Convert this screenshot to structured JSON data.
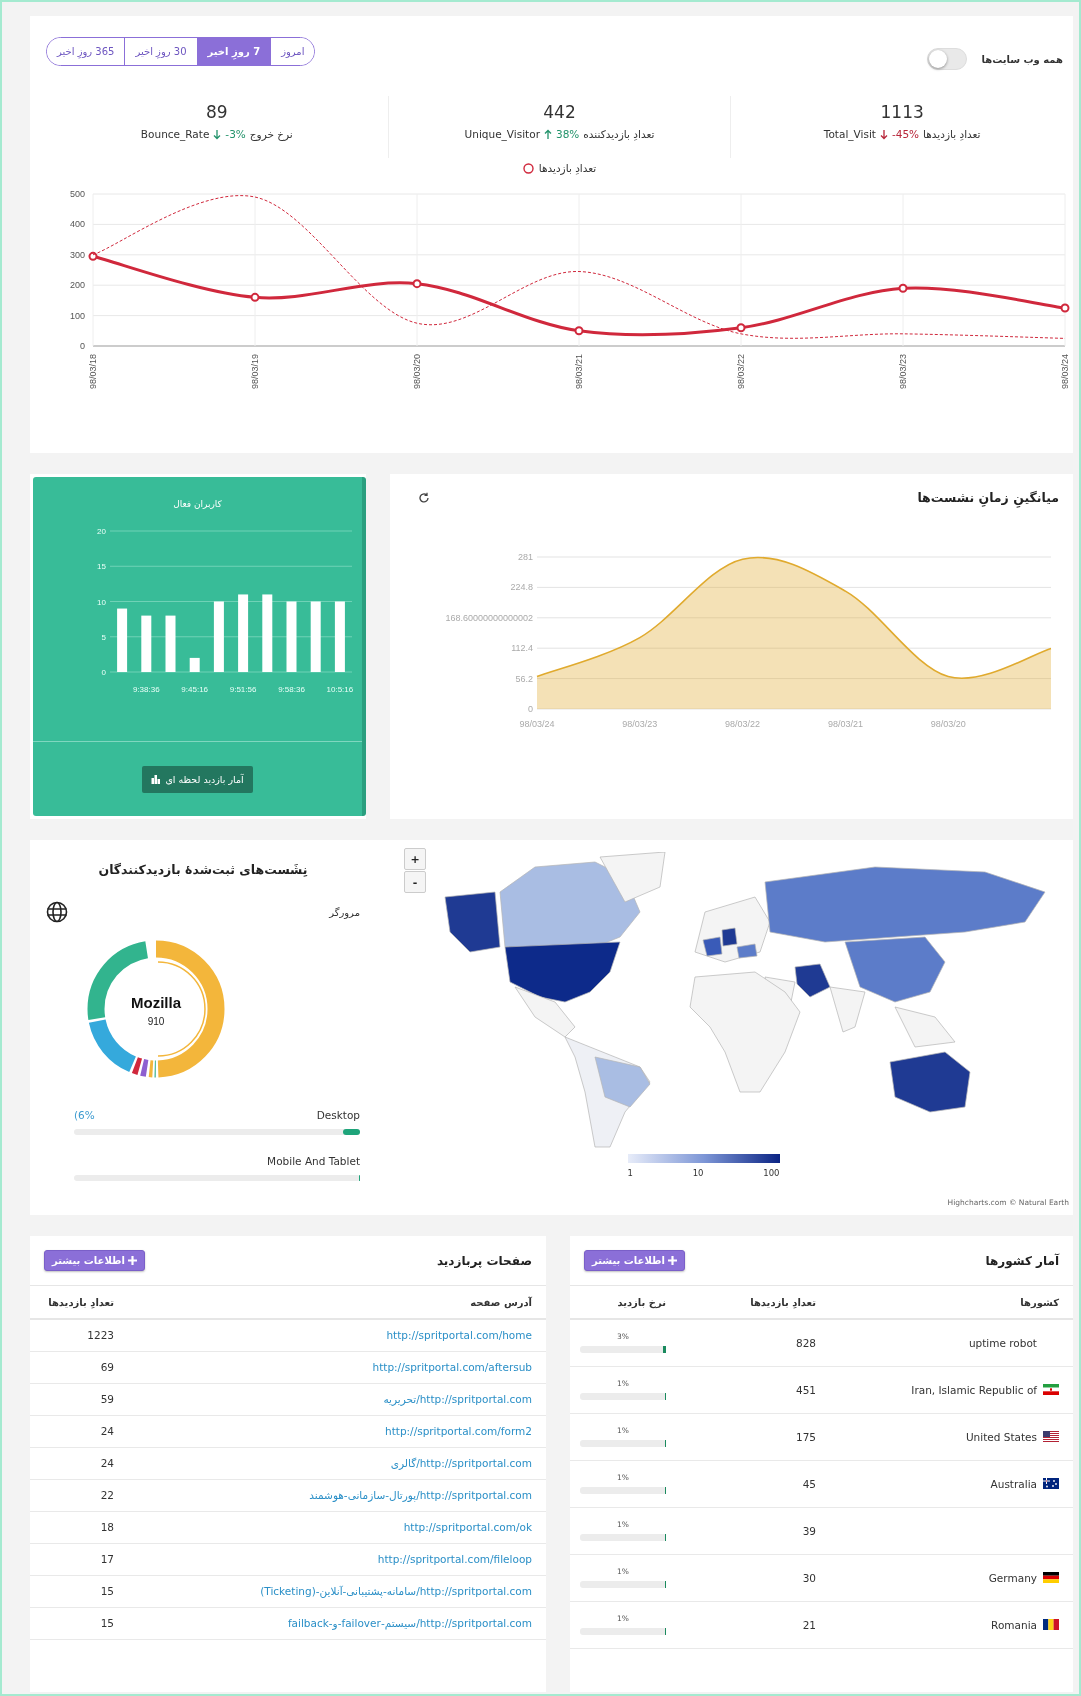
{
  "filters": {
    "all_sites": {
      "label": "همه وب سایت‌ها",
      "on": false
    },
    "tabs": [
      {
        "label": "امروز",
        "selected": false
      },
      {
        "label": "7 روزِ اخیر",
        "selected": true
      },
      {
        "label": "30 روزِ اخیر",
        "selected": false
      },
      {
        "label": "365 روزِ اخیر",
        "selected": false
      }
    ]
  },
  "stats": [
    {
      "value": "1113",
      "label": "تعدادِ بازدیدها",
      "change": "-45%",
      "color": "#b8263a",
      "key": "Total_Visit"
    },
    {
      "value": "442",
      "label": "تعدادِ بازدیدکننده",
      "change": "38%",
      "color": "#23936b",
      "key": "Unique_Visitor"
    },
    {
      "value": "89",
      "label": "نرخ خروج",
      "change": "-3%",
      "color": "#23936b",
      "key": "Bounce_Rate"
    }
  ],
  "visits_chart": {
    "chart_data": {
      "type": "line",
      "categories": [
        "98/03/18",
        "98/03/19",
        "98/03/20",
        "98/03/21",
        "98/03/22",
        "98/03/23",
        "98/03/24"
      ],
      "ylim": [
        0,
        500
      ],
      "yticks": [
        0,
        100,
        200,
        300,
        400,
        500
      ],
      "grid": true,
      "series": [
        {
          "name": "تعدادِ بازدیدها",
          "color": "#d0283c",
          "line_style": "solid",
          "marker": true,
          "values": [
            295,
            160,
            205,
            50,
            60,
            190,
            125
          ]
        },
        {
          "color": "#d0283c",
          "line_style": "dashed",
          "marker": false,
          "values": [
            300,
            490,
            75,
            245,
            40,
            40,
            25
          ]
        }
      ]
    }
  },
  "live_users": {
    "title": "کاربران فعال",
    "chart_data": {
      "type": "bar",
      "categories": [
        null,
        "9:38:36",
        null,
        "9:45:16",
        null,
        "9:51:56",
        null,
        "9:58:36",
        null,
        "10:5:16"
      ],
      "values": [
        9,
        8,
        8,
        2,
        10,
        11,
        11,
        10,
        10,
        10
      ],
      "ylim": [
        0,
        20
      ],
      "yticks": [
        0,
        5,
        10,
        15,
        20
      ],
      "grid": true
    },
    "button": "آمار بازدید لحظه ای"
  },
  "session_time": {
    "title": "میانگینِ زمانِ نشست‌ها",
    "chart_data": {
      "type": "area",
      "categories": [
        "98/03/24",
        "98/03/23",
        "98/03/22",
        "98/03/21",
        "98/03/20",
        null
      ],
      "ylim": [
        0,
        281
      ],
      "yticks": [
        0,
        56.2,
        112.4,
        {
          "value": 168.6,
          "label": "168.60000000000002"
        },
        224.8,
        281
      ],
      "grid": true,
      "series": [
        {
          "color": "#e0aa2e",
          "values": [
            60,
            132,
            277,
            218,
            60,
            112
          ]
        }
      ]
    }
  },
  "sessions": {
    "title": "نِشَست‌های ثبت‌شدهٔ بازدیدکنندگان",
    "browser_label": "مرورگر",
    "donut": {
      "name": "Mozilla",
      "value": "910"
    },
    "devices": [
      {
        "name": "Desktop",
        "reading": "(6%",
        "level": 0.06
      },
      {
        "name": "Mobile And Tablet",
        "level": 0
      }
    ]
  },
  "map": {
    "zoom_in": "+",
    "zoom_out": "-",
    "legend": [
      "100",
      "10",
      "1"
    ],
    "credit": "Highcharts.com © Natural Earth"
  },
  "top_pages": {
    "title": "صفحات پربازدید",
    "button": "اطلاعات بیشتر",
    "columns": [
      "آدرس صفحه",
      "تعدادِ بازدیدها"
    ],
    "rows": [
      {
        "url": "http://spritportal.com/home",
        "visits": "1223"
      },
      {
        "url": "http://spritportal.com/aftersub",
        "visits": "69"
      },
      {
        "url": "http://spritportal.com/تحریریه",
        "visits": "59"
      },
      {
        "url": "http://spritportal.com/form2",
        "visits": "24"
      },
      {
        "url": "http://spritportal.com/گالری",
        "visits": "24"
      },
      {
        "url": "http://spritportal.com/پورتال-سازمانی-هوشمند",
        "visits": "22"
      },
      {
        "url": "http://spritportal.com/ok",
        "visits": "18"
      },
      {
        "url": "http://spritportal.com/fileloop",
        "visits": "17"
      },
      {
        "url": "http://spritportal.com/سامانه-پشتیبانی-آنلاین-(Ticketing)",
        "visits": "15"
      },
      {
        "url": "http://spritportal.com/سیستم-failover-و-failback",
        "visits": "15"
      }
    ]
  },
  "countries": {
    "title": "آمار کشورها",
    "button": "اطلاعات بیشتر",
    "columns": [
      "کشورها",
      "تعدادِ بازدیدها",
      "نرخ بازدید"
    ],
    "rows": [
      {
        "country": "uptime robot",
        "visits": "828",
        "rate": "3%",
        "level": 0.03
      },
      {
        "country": "Iran, Islamic Republic of",
        "visits": "451",
        "rate": "1%",
        "level": 0.01
      },
      {
        "country": "United States",
        "visits": "175",
        "rate": "1%",
        "level": 0.01
      },
      {
        "country": "Australia",
        "visits": "45",
        "rate": "1%",
        "level": 0.01
      },
      {
        "visits": "39",
        "rate": "1%",
        "level": 0.01
      },
      {
        "country": "Germany",
        "visits": "30",
        "rate": "1%",
        "level": 0.01
      },
      {
        "country": "Romania",
        "visits": "21",
        "rate": "1%",
        "level": 0.01
      }
    ]
  }
}
